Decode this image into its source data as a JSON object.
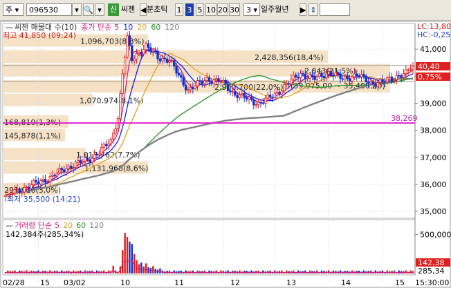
{
  "toolbar": {
    "market": "주",
    "code": "096530",
    "badge": "신",
    "name": "씨젠",
    "period_label": "분초틱",
    "periods": [
      "1",
      "3",
      "5",
      "10",
      "20",
      "30"
    ],
    "selected_period": "3",
    "interval_value": "3",
    "interval_units": "일주월년"
  },
  "price_panel": {
    "legend_name": "씨젠 매물대 수(10)",
    "legend_ma": "종가 단순",
    "ma_periods": [
      "5",
      "10",
      "20",
      "60",
      "120"
    ],
    "ma_colors": [
      "#d0207a",
      "#1818e0",
      "#e0a020",
      "#209020",
      "#808080"
    ],
    "high_label": "최고 41,850 (09:24)",
    "low_label": "최저 35,500 (14:21)",
    "lc_label": "LC:13,80",
    "hc_label": "HC:-0,25",
    "current_price": "40,40",
    "current_change": "0,75%",
    "magenta_level_label": "38,269",
    "magenta_level": 38269,
    "volume_profile": [
      {
        "price": 35800,
        "label": "291,610(3,0%)"
      },
      {
        "price": 36600,
        "label": "1,131,968(8,6%)"
      },
      {
        "price": 37100,
        "label": "1,017,762(7,7%)"
      },
      {
        "price": 37800,
        "label": "145,878(1,1%)"
      },
      {
        "price": 38300,
        "label": "168,819(1,3%)"
      },
      {
        "price": 39100,
        "label": "1,070,974(8,1%)"
      },
      {
        "price": 39600,
        "label": "2,900,700(22,0%)"
      },
      {
        "price": 39650,
        "label": "(39,975,00 ~ 35,400,00)"
      },
      {
        "price": 40200,
        "label": "2,843(21,5%)"
      },
      {
        "price": 40700,
        "label": "2,428,356(18,4%)"
      },
      {
        "price": 41300,
        "label": "1,096,703(8,3%)"
      }
    ]
  },
  "volume_panel": {
    "legend_name": "거래량 단순",
    "ma_periods": [
      "5",
      "20",
      "60",
      "120"
    ],
    "ma_colors": [
      "#d0207a",
      "#e0a020",
      "#209020",
      "#808080"
    ],
    "value_label": "142,384주(285,34%)",
    "current_volume": "142,38",
    "current_pct": "285,34"
  },
  "chart_data": {
    "type": "candlestick",
    "price_axis": {
      "min": 34800,
      "max": 41900,
      "ticks": [
        35000,
        36000,
        37000,
        38000,
        39000,
        40000,
        41000
      ],
      "tick_labels": [
        "35,000",
        "36,000",
        "37,000",
        "38,000",
        "39,000",
        "40,000",
        "41,000"
      ]
    },
    "volume_axis": {
      "max": 550000,
      "ticks": [
        500000
      ],
      "tick_labels": [
        "500,000"
      ]
    },
    "x_labels": [
      "02/28",
      "15",
      "03/02",
      "10",
      "11",
      "12",
      "13",
      "14",
      "15",
      "15:30:00"
    ],
    "close_path": [
      [
        0,
        35600
      ],
      [
        12,
        36000
      ],
      [
        20,
        36300
      ],
      [
        28,
        36700
      ],
      [
        35,
        36900
      ],
      [
        40,
        37200
      ],
      [
        45,
        37600
      ],
      [
        48,
        38500
      ],
      [
        50,
        40100
      ],
      [
        52,
        41400
      ],
      [
        54,
        40600
      ],
      [
        57,
        40900
      ],
      [
        60,
        41100
      ],
      [
        65,
        40700
      ],
      [
        70,
        40600
      ],
      [
        74,
        40000
      ],
      [
        78,
        39500
      ],
      [
        82,
        39700
      ],
      [
        86,
        39900
      ],
      [
        92,
        39800
      ],
      [
        97,
        39400
      ],
      [
        102,
        39200
      ],
      [
        108,
        39000
      ],
      [
        114,
        39250
      ],
      [
        120,
        39700
      ],
      [
        126,
        40100
      ],
      [
        132,
        39900
      ],
      [
        138,
        40150
      ],
      [
        144,
        39900
      ],
      [
        150,
        40050
      ],
      [
        156,
        39750
      ],
      [
        162,
        39800
      ],
      [
        168,
        40050
      ],
      [
        171,
        40100
      ],
      [
        173,
        40300
      ]
    ],
    "volume_bars": [
      [
        46,
        100000
      ],
      [
        49,
        90000
      ],
      [
        50,
        300000
      ],
      [
        51,
        520000
      ],
      [
        52,
        470000
      ],
      [
        53,
        410000
      ],
      [
        54,
        380000
      ],
      [
        55,
        250000
      ],
      [
        56,
        170000
      ],
      [
        57,
        120000
      ],
      [
        58,
        140000
      ],
      [
        59,
        90000
      ],
      [
        60,
        130000
      ],
      [
        61,
        80000
      ],
      [
        62,
        70000
      ],
      [
        63,
        95000
      ],
      [
        64,
        60000
      ],
      [
        65,
        50000
      ],
      [
        66,
        65000
      ]
    ],
    "series": [
      {
        "name": "5",
        "period": 5
      },
      {
        "name": "10",
        "period": 10
      },
      {
        "name": "20",
        "period": 20
      },
      {
        "name": "60",
        "period": 60
      },
      {
        "name": "120",
        "period": 120
      }
    ]
  }
}
